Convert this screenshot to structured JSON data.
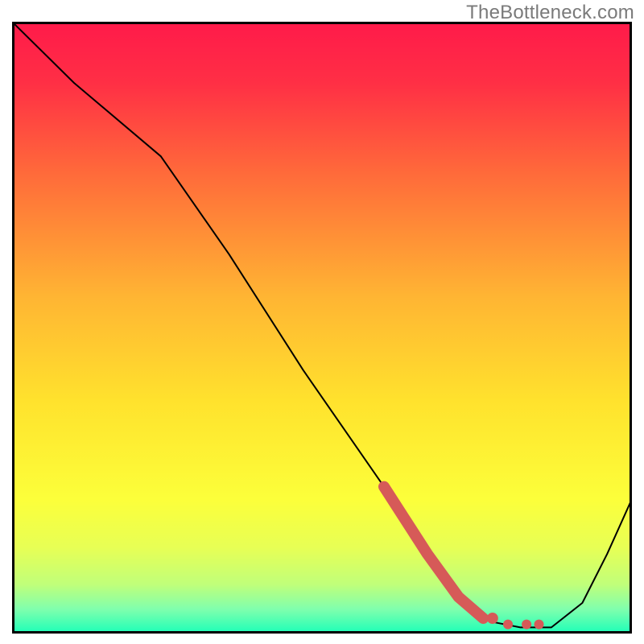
{
  "watermark": "TheBottleneck.com",
  "chart_data": {
    "type": "line",
    "title": "",
    "xlabel": "",
    "ylabel": "",
    "xlim": [
      0,
      100
    ],
    "ylim": [
      0,
      100
    ],
    "grid": false,
    "legend": false,
    "series": [
      {
        "name": "bottleneck-curve",
        "x": [
          0,
          10,
          24,
          35,
          47,
          60,
          67,
          72,
          77,
          82,
          87,
          92,
          96,
          100
        ],
        "values": [
          100,
          90,
          78,
          62,
          43,
          24,
          13,
          6,
          2,
          1,
          1,
          5,
          13,
          22
        ]
      }
    ],
    "highlight_segment": {
      "name": "marked-range",
      "color": "#d65a58",
      "x": [
        60,
        67,
        72,
        76
      ],
      "values": [
        24,
        13,
        6,
        2.5
      ]
    },
    "highlight_dots": {
      "name": "trough-points",
      "color": "#d65a58",
      "points": [
        {
          "x": 77.5,
          "y": 2.5
        },
        {
          "x": 80,
          "y": 1.5
        },
        {
          "x": 83,
          "y": 1.5
        },
        {
          "x": 85,
          "y": 1.5
        }
      ]
    },
    "background_gradient": {
      "stops": [
        {
          "offset": 0.0,
          "color": "#ff1a4a"
        },
        {
          "offset": 0.1,
          "color": "#ff2f45"
        },
        {
          "offset": 0.25,
          "color": "#ff6b3a"
        },
        {
          "offset": 0.45,
          "color": "#ffb533"
        },
        {
          "offset": 0.62,
          "color": "#ffe22d"
        },
        {
          "offset": 0.78,
          "color": "#fcff3a"
        },
        {
          "offset": 0.86,
          "color": "#e7ff55"
        },
        {
          "offset": 0.92,
          "color": "#c0ff7a"
        },
        {
          "offset": 0.96,
          "color": "#80ffad"
        },
        {
          "offset": 1.0,
          "color": "#1bffb8"
        }
      ]
    }
  }
}
